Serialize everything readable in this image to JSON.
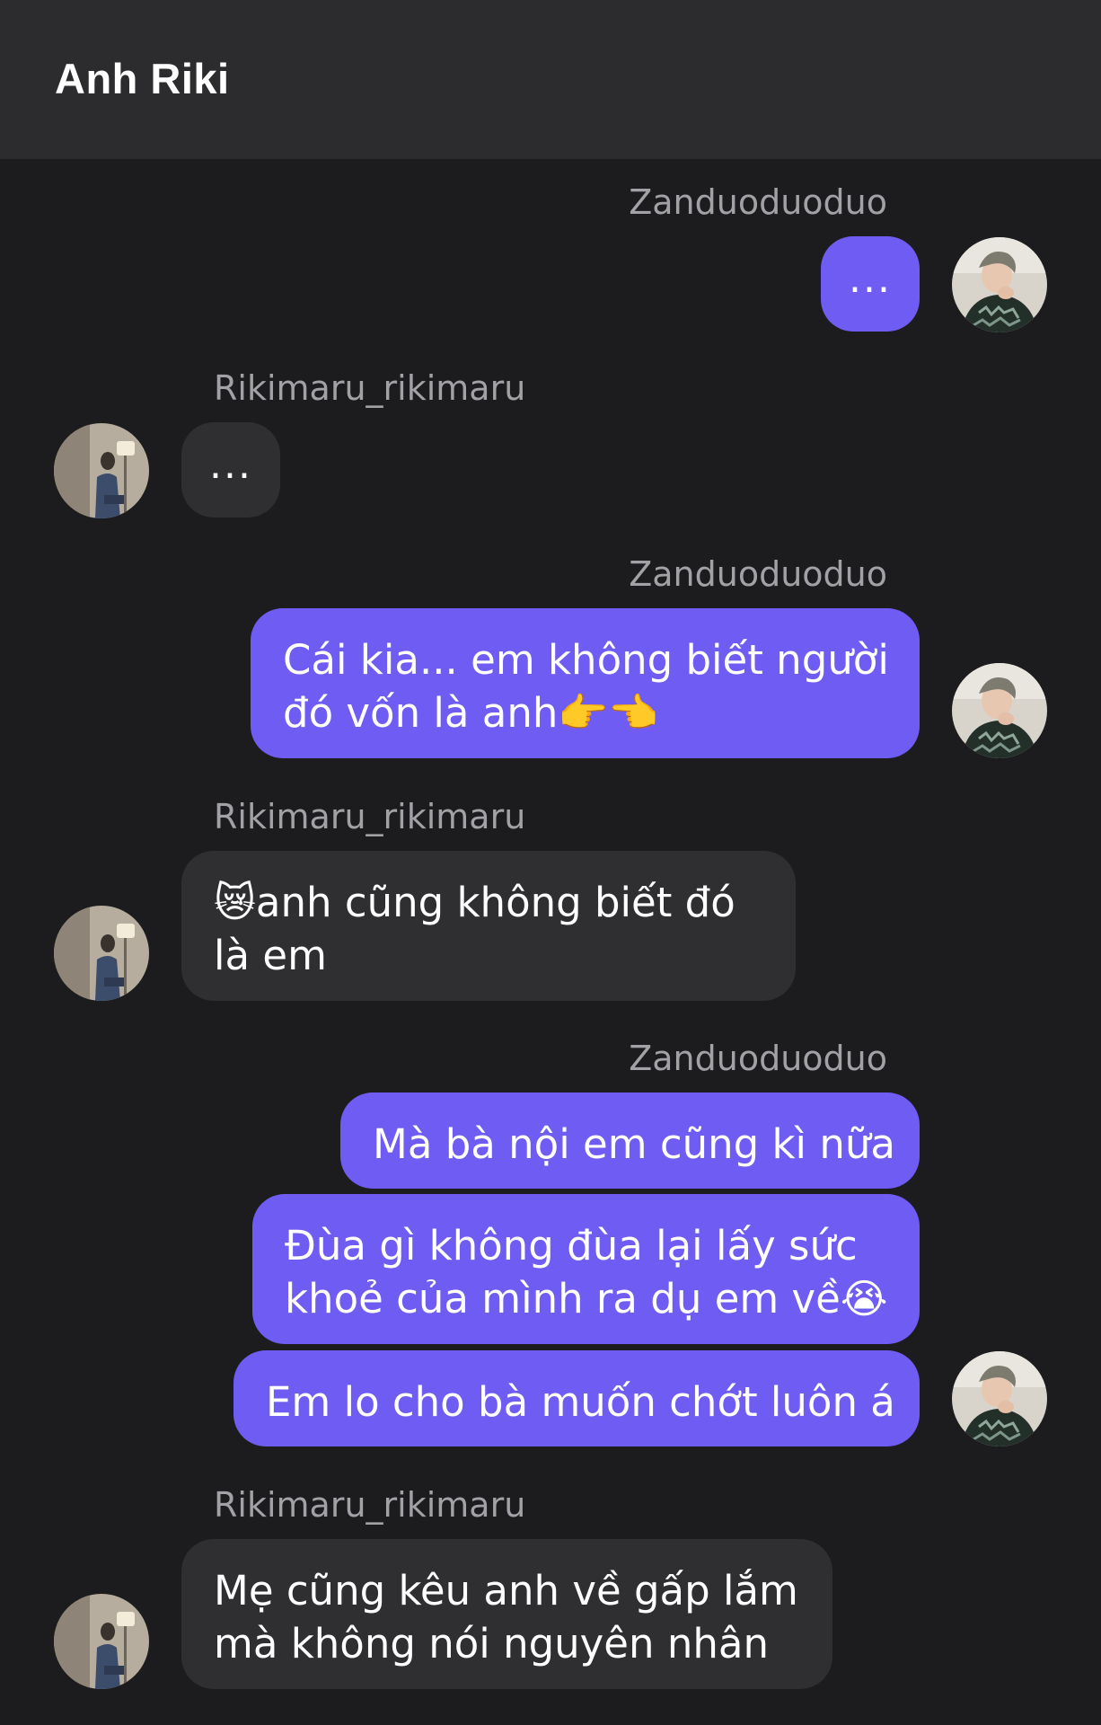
{
  "header": {
    "title": "Anh Riki"
  },
  "participants": {
    "me": "Zanduoduoduo",
    "other": "Rikimaru_rikimaru"
  },
  "messages": [
    {
      "sender": "Zanduoduoduo",
      "lines": [
        "..."
      ]
    },
    {
      "sender": "Rikimaru_rikimaru",
      "lines": [
        "..."
      ]
    },
    {
      "sender": "Zanduoduoduo",
      "lines": [
        "Cái kia... em không biết người",
        "đó vốn là anh👉👈"
      ]
    },
    {
      "sender": "Rikimaru_rikimaru",
      "lines": [
        "😿anh cũng không biết đó",
        "là em"
      ]
    },
    {
      "sender": "Zanduoduoduo",
      "lines": [
        "Mà bà nội em cũng kì nữa"
      ]
    },
    {
      "sender": "Zanduoduoduo",
      "lines": [
        "Đùa gì không đùa lại lấy sức",
        "khoẻ của mình ra dụ em về😭"
      ]
    },
    {
      "sender": "Zanduoduoduo",
      "lines": [
        "Em lo cho bà muốn chớt luôn á"
      ]
    },
    {
      "sender": "Rikimaru_rikimaru",
      "lines": [
        "Mẹ cũng kêu anh về gấp lắm",
        "mà không nói nguyên nhân"
      ]
    }
  ],
  "colors": {
    "outgoing_bubble": "#6f5cf2",
    "incoming_bubble": "#2f2f32",
    "background": "#1c1c1e",
    "header": "#2c2c2e"
  },
  "icons": {
    "avatar_me": "avatar-zanduoduoduo",
    "avatar_other": "avatar-rikimaru"
  }
}
